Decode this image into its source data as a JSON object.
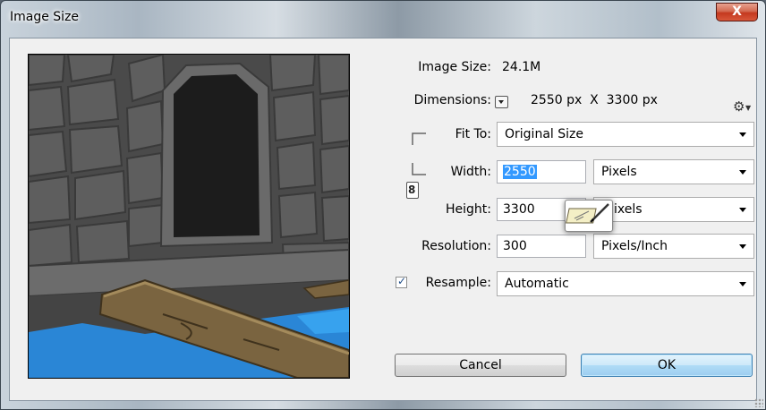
{
  "window": {
    "title": "Image Size",
    "close_glyph": "X"
  },
  "info": {
    "image_size_label": "Image Size:",
    "image_size_value": "24.1M",
    "dimensions_label": "Dimensions:",
    "dimensions_value": "2550 px  X  3300 px"
  },
  "fit_to": {
    "label": "Fit To:",
    "value": "Original Size"
  },
  "width": {
    "label": "Width:",
    "value": "2550",
    "unit": "Pixels"
  },
  "height": {
    "label": "Height:",
    "value": "3300",
    "unit": "ixels"
  },
  "resolution": {
    "label": "Resolution:",
    "value": "300",
    "unit": "Pixels/Inch"
  },
  "resample": {
    "label": "Resample:",
    "checked": true,
    "value": "Automatic"
  },
  "buttons": {
    "cancel": "Cancel",
    "ok": "OK"
  },
  "icons": {
    "settings": "gear-icon",
    "link": "chain-link-icon",
    "tooltip": "resize-cursor-icon"
  },
  "colors": {
    "selection": "#3399ff",
    "ok_button": "#9ccdf0",
    "close_button": "#c4391f",
    "water": "#2a86d6",
    "wood": "#7a6440"
  }
}
